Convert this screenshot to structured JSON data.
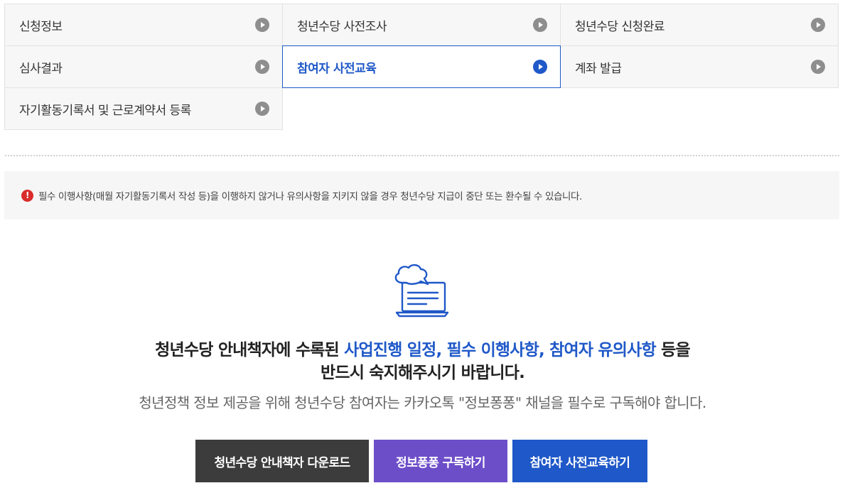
{
  "menu": {
    "items": [
      {
        "label": "신청정보",
        "active": false
      },
      {
        "label": "청년수당 사전조사",
        "active": false
      },
      {
        "label": "청년수당 신청완료",
        "active": false
      },
      {
        "label": "심사결과",
        "active": false
      },
      {
        "label": "참여자 사전교육",
        "active": true
      },
      {
        "label": "계좌 발급",
        "active": false
      },
      {
        "label": "자기활동기록서 및 근로계약서 등록",
        "active": false
      }
    ]
  },
  "notice": {
    "icon": "warning-icon",
    "text": "필수 이행사항(매월 자기활동기록서 작성 등)을 이행하지 않거나 유의사항을 지키지 않을 경우 청년수당 지급이 중단 또는 환수될 수 있습니다."
  },
  "hero": {
    "icon": "chat-laptop-icon",
    "line1_prefix": "청년수당 안내책자에 수록된 ",
    "line1_highlight": "사업진행 일정, 필수 이행사항, 참여자 유의사항",
    "line1_suffix": " 등을",
    "line2": "반드시 숙지해주시기 바랍니다.",
    "subtext": "청년정책 정보 제공을 위해 청년수당 참여자는 카카오톡 \"정보퐁퐁\" 채널을 필수로 구독해야 합니다."
  },
  "buttons": {
    "download_label": "청년수당 안내책자 다운로드",
    "subscribe_label": "정보퐁퐁 구독하기",
    "education_label": "참여자 사전교육하기"
  },
  "colors": {
    "accent": "#1f58c8",
    "purple": "#6d4ec9",
    "dark": "#3c3c3c",
    "warning": "#d92b2b"
  }
}
